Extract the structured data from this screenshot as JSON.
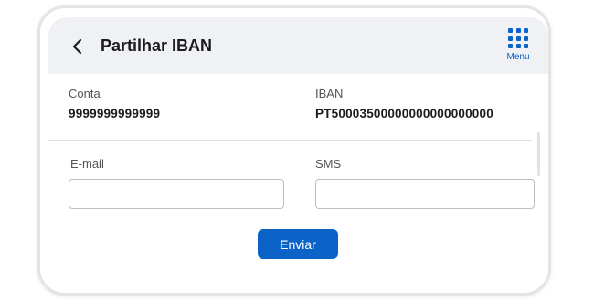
{
  "header": {
    "back_icon": "chevron-left-icon",
    "title": "Partilhar IBAN",
    "menu_icon": "grid-icon",
    "menu_label": "Menu"
  },
  "account": {
    "conta_label": "Conta",
    "conta_value": "9999999999999",
    "iban_label": "IBAN",
    "iban_value": "PT50003500000000000000000"
  },
  "form": {
    "email_label": "E-mail",
    "email_value": "",
    "sms_label": "SMS",
    "sms_value": "",
    "submit_label": "Enviar"
  },
  "colors": {
    "accent": "#0b63c8",
    "header_bg": "#eff1f5"
  }
}
